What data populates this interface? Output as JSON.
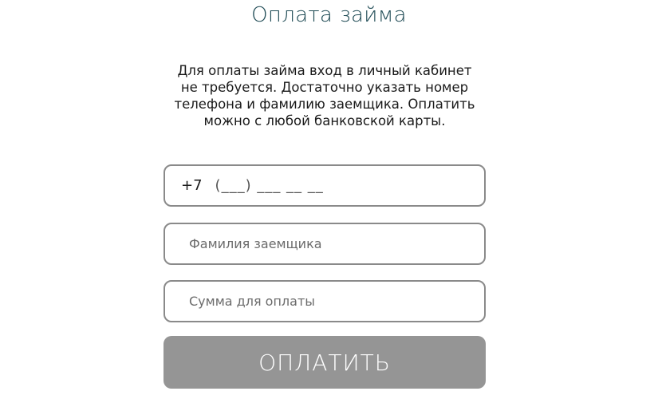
{
  "page": {
    "title": "Оплата займа",
    "description": "Для оплаты займа вход в личный кабинет не требуется. Достаточно указать номер телефона и фамилию заемщика. Оплатить можно с любой банковской карты."
  },
  "form": {
    "phone": {
      "prefix": "+7",
      "mask": "(___) ___ __ __"
    },
    "surname": {
      "placeholder": "Фамилия заемщика"
    },
    "amount": {
      "placeholder": "Сумма для оплаты"
    },
    "submit_label": "ОПЛАТИТЬ"
  },
  "colors": {
    "title": "#1f4b55",
    "button_bg": "#959595",
    "border": "#8a8a8a"
  }
}
